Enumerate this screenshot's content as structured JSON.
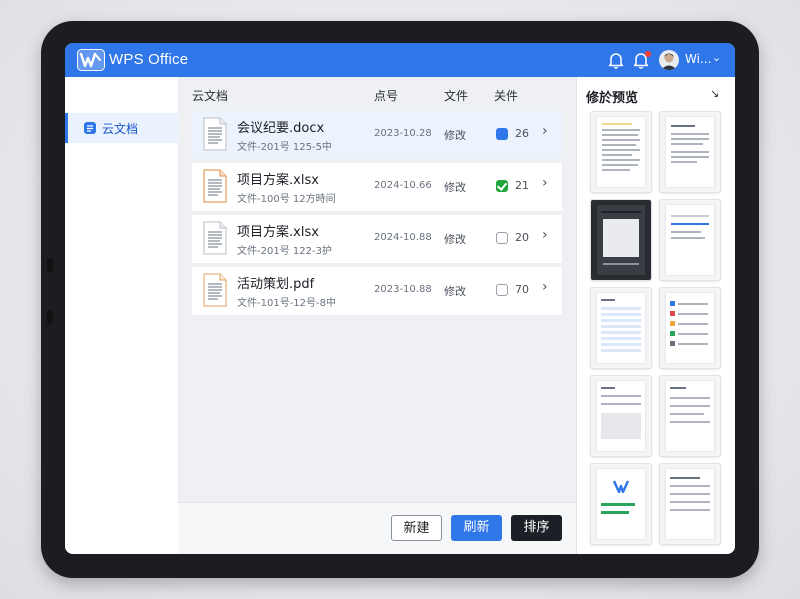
{
  "app": {
    "brand": "WPS Office",
    "user": "Wi...",
    "accent": "#2f76e8"
  },
  "sidebar": {
    "items": [
      {
        "label": "云文档",
        "icon": "cloud-doc-icon",
        "active": true
      }
    ]
  },
  "table": {
    "headers": {
      "name": "云文档",
      "time": "点号",
      "action": "文件",
      "status": "关件"
    },
    "rows": [
      {
        "name": "会议纪要.docx",
        "sub": "文件-201号 125-5中",
        "date": "2023-10.28",
        "action": "修改",
        "checkbox": "blue",
        "count": "26",
        "type": "doc"
      },
      {
        "name": "项目方案.xlsx",
        "sub": "文件-100号 12方時间",
        "date": "2024-10.66",
        "action": "修改",
        "checkbox": "checked",
        "count": "21",
        "type": "xls"
      },
      {
        "name": "项目方案.xlsx",
        "sub": "文件-201号 122-3护",
        "date": "2024-10.88",
        "action": "修改",
        "checkbox": "empty",
        "count": "20",
        "type": "doc"
      },
      {
        "name": "活动策划.pdf",
        "sub": "文件-101号-12号-8中",
        "date": "2023-10.88",
        "action": "修改",
        "checkbox": "empty",
        "count": "70",
        "type": "pdf"
      }
    ]
  },
  "footer": {
    "new_label": "新建",
    "refresh_label": "刷新",
    "sort_label": "排序"
  },
  "preview": {
    "title": "修於预览",
    "arrow": "↘"
  }
}
